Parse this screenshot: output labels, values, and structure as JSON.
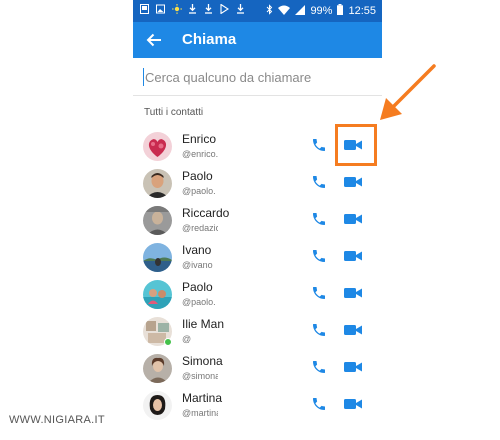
{
  "status_bar": {
    "battery_percent": "99%",
    "time": "12:55",
    "left_icons": [
      "gallery-icon",
      "image-icon",
      "brightness-icon",
      "download-icon",
      "download-icon",
      "play-store-icon",
      "download-icon"
    ],
    "right_icons": [
      "bluetooth-icon",
      "wifi-icon",
      "signal-icon",
      "battery-icon"
    ]
  },
  "app_bar": {
    "title": "Chiama",
    "back_icon": "arrow-left-icon",
    "color": "#1e88e5"
  },
  "search": {
    "placeholder": "Cerca qualcuno da chiamare",
    "value": ""
  },
  "section_title": "Tutti i contatti",
  "contacts": [
    {
      "name": "Enrico",
      "handle": "@enrico.",
      "online": false
    },
    {
      "name": "Paolo",
      "handle": "@paolo.",
      "online": false
    },
    {
      "name": "Riccardo S",
      "handle": "@redazione.f",
      "online": false
    },
    {
      "name": "Ivano",
      "handle": "@ivano",
      "online": false
    },
    {
      "name": "Paolo",
      "handle": "@paolo.",
      "online": false
    },
    {
      "name": "Ilie Man",
      "handle": "@",
      "online": true
    },
    {
      "name": "Simona",
      "handle": "@simona.s",
      "online": false
    },
    {
      "name": "Martina",
      "handle": "@martina.",
      "online": false
    }
  ],
  "icons": {
    "call": "phone-icon",
    "video": "video-camera-icon"
  },
  "colors": {
    "accent": "#1e88e5",
    "status_bar": "#1565c0",
    "highlight": "#f57c20",
    "online": "#44c14a"
  },
  "watermark": "WWW.NIGIARA.IT"
}
